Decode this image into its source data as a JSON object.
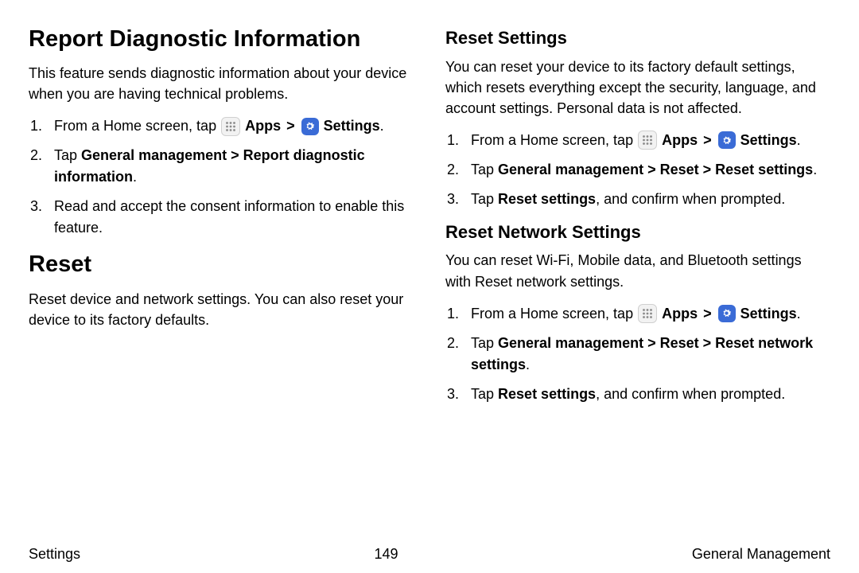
{
  "left": {
    "h1a": "Report Diagnostic Information",
    "intro_a": "This feature sends diagnostic information about your device when you are having technical problems.",
    "steps_a": {
      "s1_pre": "From a Home screen, tap ",
      "s1_apps": "Apps",
      "s1_settings": "Settings",
      "s2_pre": "Tap ",
      "s2_bold": "General management > Report diagnostic information",
      "s3": "Read and accept the consent information to enable this feature."
    },
    "h1b": "Reset",
    "intro_b": "Reset device and network settings. You can also reset your device to its factory defaults."
  },
  "right": {
    "h2a": "Reset Settings",
    "intro_a": "You can reset your device to its factory default settings, which resets everything except the security, language, and account settings. Personal data is not affected.",
    "steps_a": {
      "s1_pre": "From a Home screen, tap ",
      "s1_apps": "Apps",
      "s1_settings": "Settings",
      "s2_pre": "Tap ",
      "s2_bold": "General management > Reset > Reset settings",
      "s3_pre": "Tap ",
      "s3_bold": "Reset settings",
      "s3_post": ", and confirm when prompted."
    },
    "h2b": "Reset Network Settings",
    "intro_b": "You can reset Wi-Fi, Mobile data, and Bluetooth settings with Reset network settings.",
    "steps_b": {
      "s1_pre": "From a Home screen, tap ",
      "s1_apps": "Apps",
      "s1_settings": "Settings",
      "s2_pre": "Tap ",
      "s2_bold": "General management > Reset > Reset network settings",
      "s3_pre": "Tap ",
      "s3_bold": "Reset settings",
      "s3_post": ", and confirm when prompted."
    }
  },
  "footer": {
    "left": "Settings",
    "center": "149",
    "right": "General Management"
  },
  "chev": ">",
  "period": "."
}
